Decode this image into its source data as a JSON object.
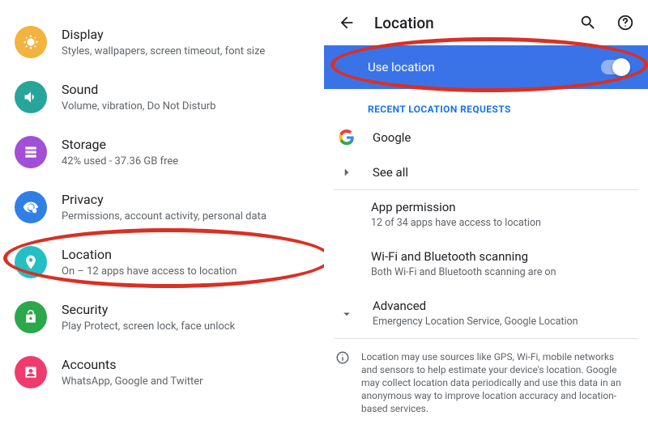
{
  "settings_list": {
    "display": {
      "title": "Display",
      "subtitle": "Styles, wallpapers, screen timeout, font size"
    },
    "sound": {
      "title": "Sound",
      "subtitle": "Volume, vibration, Do Not Disturb"
    },
    "storage": {
      "title": "Storage",
      "subtitle": "42% used - 37.36 GB free"
    },
    "privacy": {
      "title": "Privacy",
      "subtitle": "Permissions, account activity, personal data"
    },
    "location": {
      "title": "Location",
      "subtitle": "On – 12 apps have access to location"
    },
    "security": {
      "title": "Security",
      "subtitle": "Play Protect, screen lock, face unlock"
    },
    "accounts": {
      "title": "Accounts",
      "subtitle": "WhatsApp, Google and Twitter"
    }
  },
  "location_page": {
    "header_title": "Location",
    "use_location_label": "Use location",
    "recent_label": "RECENT LOCATION REQUESTS",
    "google": "Google",
    "see_all": "See all",
    "app_permission": {
      "title": "App permission",
      "subtitle": "12 of 34 apps have access to location"
    },
    "wifi_bt": {
      "title": "Wi-Fi and Bluetooth scanning",
      "subtitle": "Both Wi-Fi and Bluetooth scanning are on"
    },
    "advanced": {
      "title": "Advanced",
      "subtitle": "Emergency Location Service, Google Location"
    },
    "info": "Location may use sources like GPS, Wi-Fi, mobile networks and sensors to help estimate your device's location. Google may collect location data periodically and use this data in an anonymous way to improve location accuracy and location-based services."
  }
}
